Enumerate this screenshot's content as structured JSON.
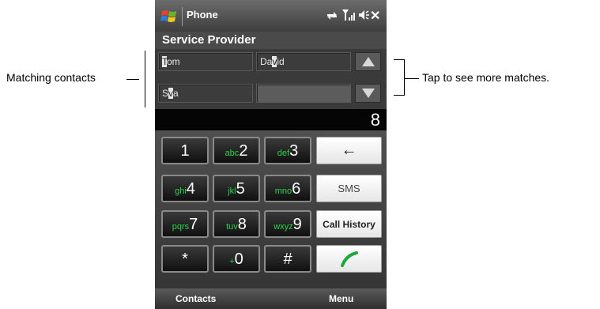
{
  "annotations": {
    "left_label": "Matching contacts",
    "right_label": "Tap to see more matches."
  },
  "titlebar": {
    "app_title": "Phone",
    "icons": [
      "windows-logo-icon",
      "connectivity-icon",
      "signal-icon",
      "volume-icon",
      "close-icon"
    ]
  },
  "provider": "Service Provider",
  "contacts": {
    "items": [
      {
        "hl": "T",
        "rest": "om"
      },
      {
        "pre": "Da",
        "hl": "v",
        "rest": "id"
      },
      {
        "pre": "S",
        "hl": "v",
        "rest": "a"
      },
      {
        "text": ""
      }
    ]
  },
  "dialed_number": "8",
  "keypad": {
    "keys": [
      {
        "sub": "",
        "num": "1"
      },
      {
        "sub": "abc",
        "num": "2"
      },
      {
        "sub": "def",
        "num": "3"
      },
      {
        "sub": "ghi",
        "num": "4"
      },
      {
        "sub": "jkl",
        "num": "5"
      },
      {
        "sub": "mno",
        "num": "6"
      },
      {
        "sub": "pqrs",
        "num": "7"
      },
      {
        "sub": "tuv",
        "num": "8"
      },
      {
        "sub": "wxyz",
        "num": "9"
      },
      {
        "sub": "",
        "num": "*"
      },
      {
        "sub": "+",
        "num": "0"
      },
      {
        "sub": "",
        "num": "#"
      }
    ],
    "backspace_label": "←",
    "sms_label": "SMS",
    "call_history_label": "Call History"
  },
  "softkeys": {
    "left": "Contacts",
    "right": "Menu"
  },
  "colors": {
    "key_sub_text": "#27d64b",
    "call_icon": "#1fa83a"
  }
}
